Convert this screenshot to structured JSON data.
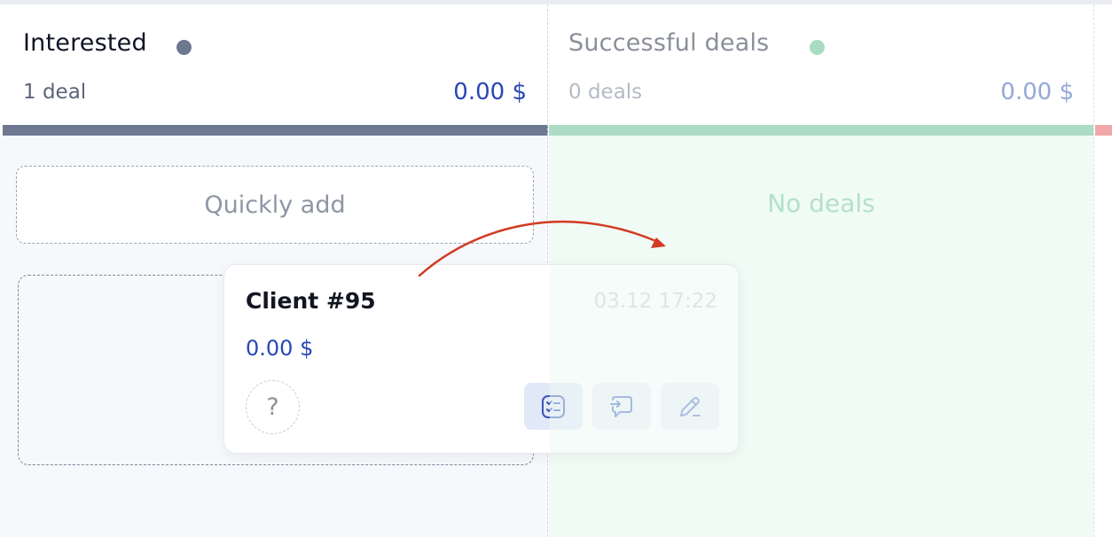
{
  "columns": [
    {
      "title": "Interested",
      "count": "1 deal",
      "amount": "0.00 $",
      "dot_color": "#6d7790",
      "bar_color": "#6e7891",
      "quick_add_label": "Quickly add"
    },
    {
      "title": "Successful deals",
      "count": "0 deals",
      "amount": "0.00 $",
      "dot_color": "#a7dcc3",
      "bar_color": "#acdcc5",
      "empty_label": "No deals"
    }
  ],
  "next_column_bar_color": "#f1a9a9",
  "drag_card": {
    "name": "Client #95",
    "timestamp": "03.12 17:22",
    "amount": "0.00 $",
    "avatar_placeholder": "?",
    "actions": [
      {
        "icon": "checklist-icon"
      },
      {
        "icon": "message-icon"
      },
      {
        "icon": "edit-icon"
      }
    ]
  },
  "accent_colors": {
    "amount_blue": "#2a47b5",
    "arrow_red": "#d23a22"
  }
}
